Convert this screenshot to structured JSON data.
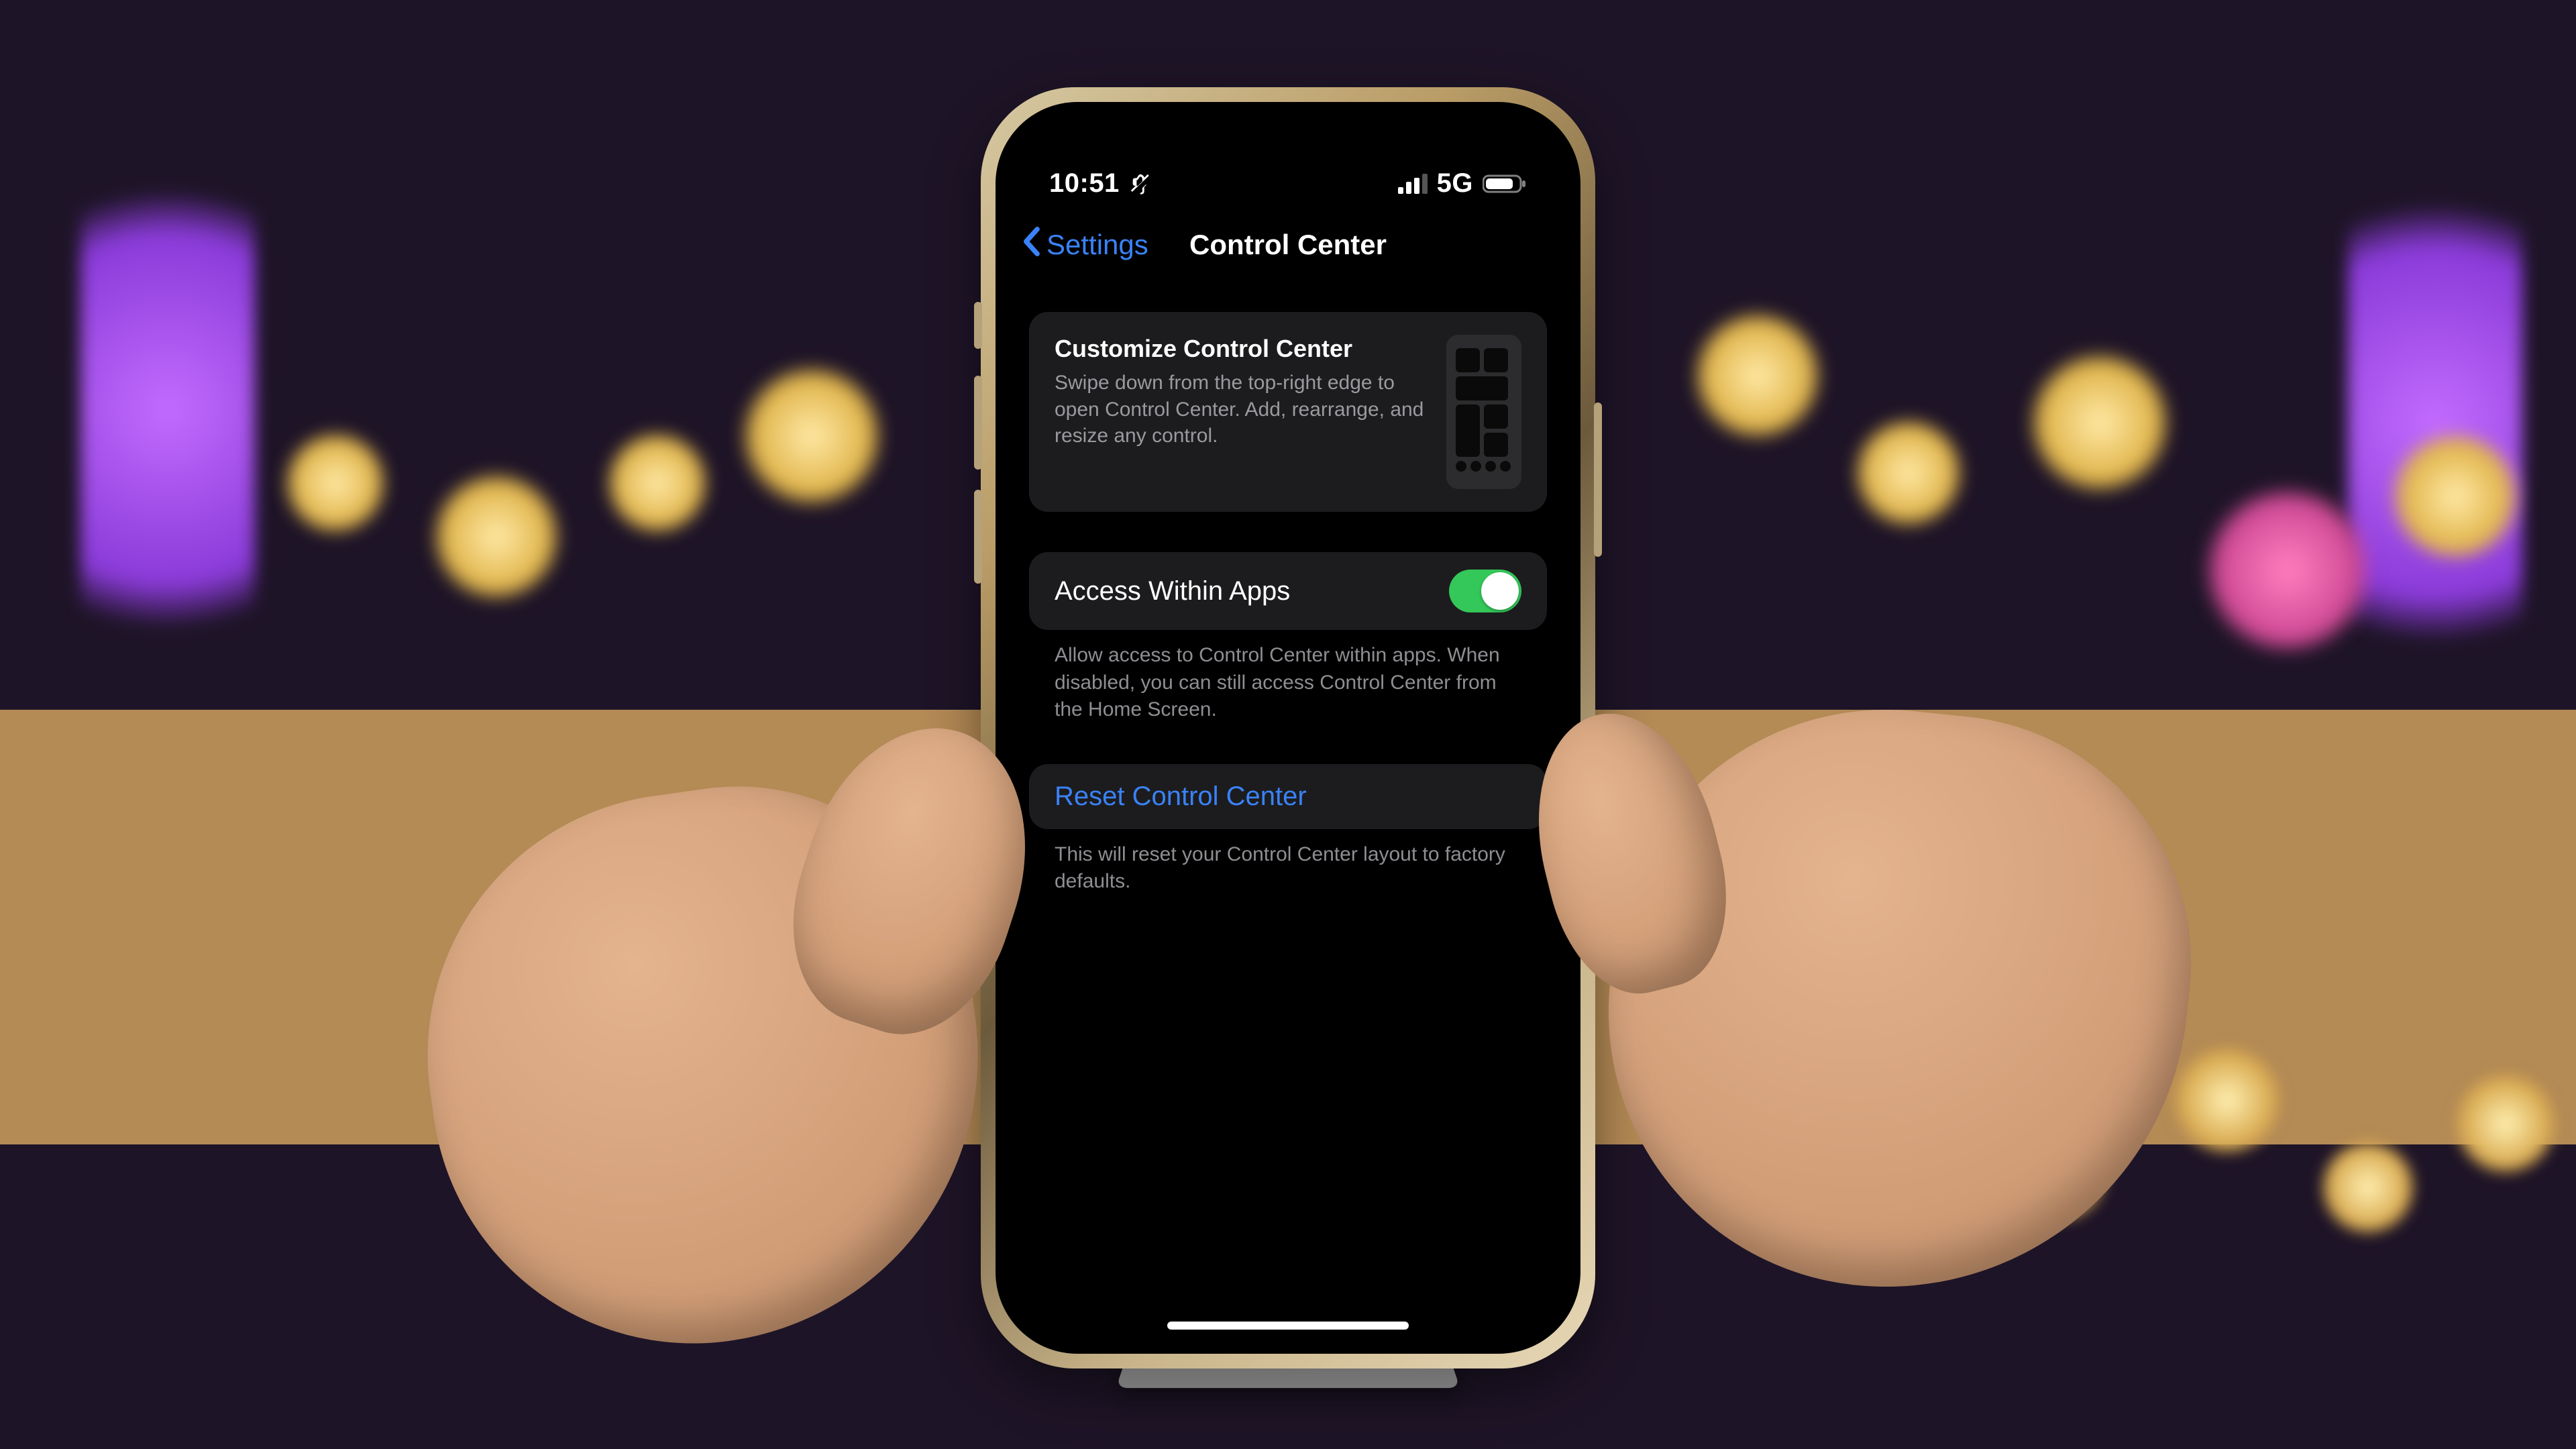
{
  "status": {
    "time": "10:51",
    "network_label": "5G"
  },
  "nav": {
    "back_label": "Settings",
    "title": "Control Center"
  },
  "hero": {
    "title": "Customize Control Center",
    "subtitle": "Swipe down from the top-right edge to open Control Center. Add, rearrange, and resize any control."
  },
  "access": {
    "label": "Access Within Apps",
    "footer": "Allow access to Control Center within apps. When disabled, you can still access Control Center from the Home Screen.",
    "on": true
  },
  "reset": {
    "label": "Reset Control Center",
    "footer": "This will reset your Control Center layout to factory defaults."
  },
  "colors": {
    "accent": "#3a82f7",
    "toggle_on": "#34c759",
    "cell_bg": "#1c1c1e",
    "secondary_text": "#8e8e93"
  }
}
